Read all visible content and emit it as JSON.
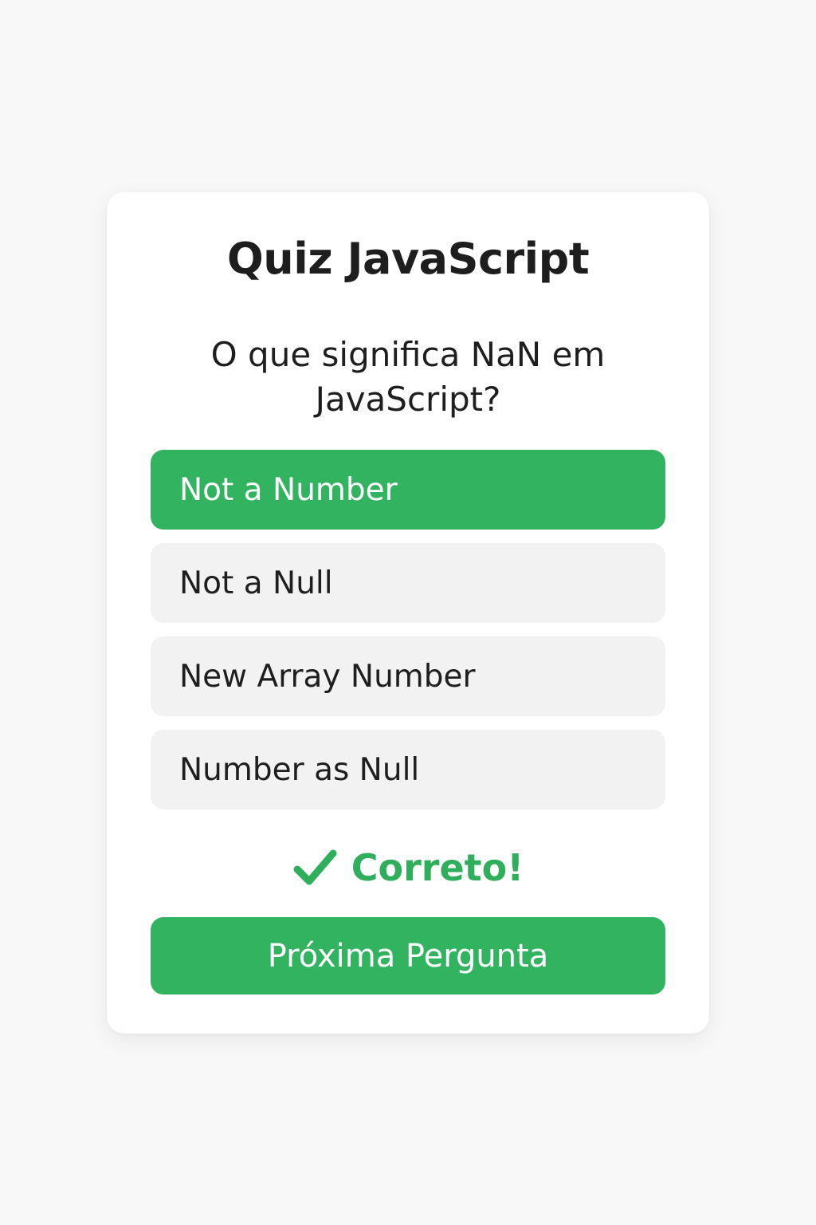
{
  "quiz": {
    "title": "Quiz JavaScript",
    "question": "O que significa NaN em JavaScript?",
    "options": [
      {
        "label": "Not a Number",
        "state": "correct"
      },
      {
        "label": "Not a Null",
        "state": "default"
      },
      {
        "label": "New Array Number",
        "state": "default"
      },
      {
        "label": "Number as Null",
        "state": "default"
      }
    ],
    "feedback": {
      "icon": "checkmark-icon",
      "text": "Correto!"
    },
    "next_button_label": "Próxima Pergunta"
  },
  "colors": {
    "page_background": "#f8f8f8",
    "card_background": "#ffffff",
    "accent_green": "#32b35f",
    "option_background": "#f2f2f2",
    "text": "#1e1e1e"
  }
}
